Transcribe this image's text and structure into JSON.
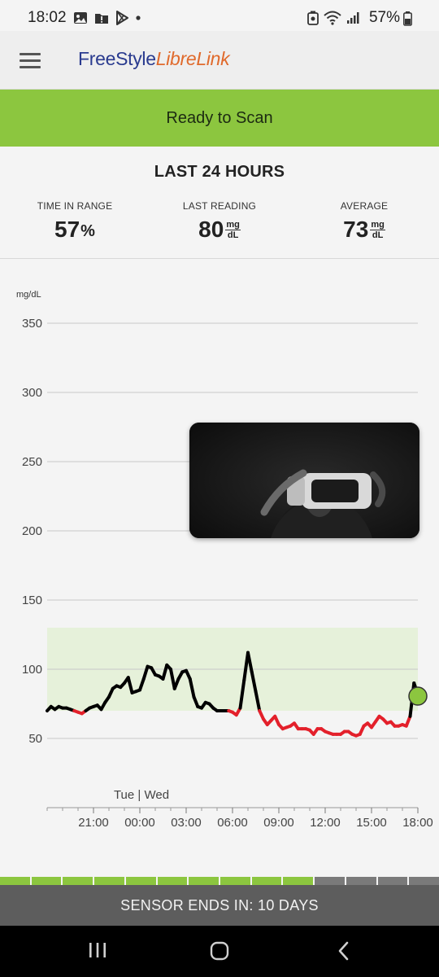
{
  "status_bar": {
    "time": "18:02",
    "battery_pct": "57%",
    "left_icons": [
      "gallery-icon",
      "alert-icon",
      "play-store-icon",
      "dot-icon"
    ],
    "right_icons": [
      "recycle-icon",
      "wifi-icon",
      "signal-icon",
      "battery-icon"
    ]
  },
  "header": {
    "logo_part1": "FreeStyle",
    "logo_part2": "LibreLink",
    "menu_icon": "hamburger-menu-icon"
  },
  "scan_banner": {
    "label": "Ready to Scan",
    "color": "#8cc63f"
  },
  "summary": {
    "title": "LAST 24 HOURS",
    "time_in_range": {
      "label": "TIME IN RANGE",
      "value": "57",
      "unit": "%"
    },
    "last_reading": {
      "label": "LAST READING",
      "value": "80",
      "unit_top": "mg",
      "unit_bottom": "dL"
    },
    "average": {
      "label": "AVERAGE",
      "value": "73",
      "unit_top": "mg",
      "unit_bottom": "dL"
    }
  },
  "chart_data": {
    "type": "line",
    "ylabel": "mg/dL",
    "ylim": [
      0,
      360
    ],
    "yticks": [
      50,
      100,
      150,
      200,
      250,
      300,
      350
    ],
    "xlabel_day": "Tue | Wed",
    "xticks": [
      "21:00",
      "00:00",
      "03:00",
      "06:00",
      "09:00",
      "12:00",
      "15:00",
      "18:00"
    ],
    "target_range": [
      70,
      130
    ],
    "colors": {
      "in_range": "#000000",
      "low": "#e3202b",
      "target_fill": "#e6f1da",
      "current_point": "#8cc63f"
    },
    "series": [
      {
        "points": [
          [
            "18:00",
            70
          ],
          [
            "18:15",
            73
          ],
          [
            "18:30",
            71
          ],
          [
            "18:45",
            73
          ],
          [
            "19:00",
            72
          ],
          [
            "19:15",
            72
          ],
          [
            "19:30",
            71
          ],
          [
            "19:45",
            70
          ],
          [
            "20:00",
            69
          ],
          [
            "20:15",
            68
          ],
          [
            "20:30",
            70
          ],
          [
            "20:45",
            72
          ],
          [
            "21:00",
            73
          ],
          [
            "21:15",
            74
          ],
          [
            "21:30",
            71
          ],
          [
            "21:45",
            76
          ],
          [
            "22:00",
            80
          ],
          [
            "22:15",
            86
          ],
          [
            "22:30",
            88
          ],
          [
            "22:45",
            87
          ],
          [
            "23:00",
            90
          ],
          [
            "23:15",
            94
          ],
          [
            "23:30",
            83
          ],
          [
            "23:45",
            84
          ],
          [
            "00:00",
            85
          ],
          [
            "00:15",
            93
          ],
          [
            "00:30",
            102
          ],
          [
            "00:45",
            101
          ],
          [
            "01:00",
            96
          ],
          [
            "01:15",
            95
          ],
          [
            "01:30",
            93
          ],
          [
            "01:45",
            103
          ],
          [
            "02:00",
            100
          ],
          [
            "02:15",
            86
          ],
          [
            "02:30",
            93
          ],
          [
            "02:45",
            98
          ],
          [
            "03:00",
            99
          ],
          [
            "03:15",
            93
          ],
          [
            "03:30",
            80
          ],
          [
            "03:45",
            73
          ],
          [
            "04:00",
            72
          ],
          [
            "04:15",
            76
          ],
          [
            "04:30",
            75
          ],
          [
            "04:45",
            72
          ],
          [
            "05:00",
            70
          ],
          [
            "05:15",
            70
          ],
          [
            "05:30",
            70
          ],
          [
            "05:45",
            70
          ],
          [
            "06:00",
            69
          ],
          [
            "06:15",
            67
          ],
          [
            "06:30",
            72
          ],
          [
            "06:45",
            92
          ],
          [
            "07:00",
            112
          ],
          [
            "07:15",
            98
          ],
          [
            "07:30",
            84
          ],
          [
            "07:45",
            70
          ],
          [
            "08:00",
            64
          ],
          [
            "08:15",
            60
          ],
          [
            "08:30",
            63
          ],
          [
            "08:45",
            66
          ],
          [
            "09:00",
            60
          ],
          [
            "09:15",
            57
          ],
          [
            "09:30",
            58
          ],
          [
            "09:45",
            59
          ],
          [
            "10:00",
            61
          ],
          [
            "10:15",
            57
          ],
          [
            "10:30",
            57
          ],
          [
            "10:45",
            57
          ],
          [
            "11:00",
            56
          ],
          [
            "11:15",
            53
          ],
          [
            "11:30",
            57
          ],
          [
            "11:45",
            57
          ],
          [
            "12:00",
            55
          ],
          [
            "12:15",
            54
          ],
          [
            "12:30",
            53
          ],
          [
            "12:45",
            53
          ],
          [
            "13:00",
            53
          ],
          [
            "13:15",
            55
          ],
          [
            "13:30",
            55
          ],
          [
            "13:45",
            53
          ],
          [
            "14:00",
            52
          ],
          [
            "14:15",
            53
          ],
          [
            "14:30",
            59
          ],
          [
            "14:45",
            61
          ],
          [
            "15:00",
            58
          ],
          [
            "15:15",
            62
          ],
          [
            "15:30",
            66
          ],
          [
            "15:45",
            64
          ],
          [
            "16:00",
            61
          ],
          [
            "16:15",
            62
          ],
          [
            "16:30",
            59
          ],
          [
            "16:45",
            59
          ],
          [
            "17:00",
            60
          ],
          [
            "17:15",
            59
          ],
          [
            "17:30",
            66
          ],
          [
            "17:45",
            90
          ],
          [
            "18:00",
            82
          ]
        ]
      }
    ],
    "current_point": [
      "18:00",
      80
    ]
  },
  "pip_overlay": {
    "thumbnail_icon": "vr-headset-video-thumbnail"
  },
  "sensor": {
    "segments_total": 14,
    "segments_filled": 10,
    "filled_color": "#8cc63f",
    "empty_color": "#7a7a7a",
    "label": "SENSOR ENDS IN: 10 DAYS"
  },
  "nav_bar": {
    "recents_icon": "recents-icon",
    "home_icon": "home-icon",
    "back_icon": "back-icon"
  }
}
